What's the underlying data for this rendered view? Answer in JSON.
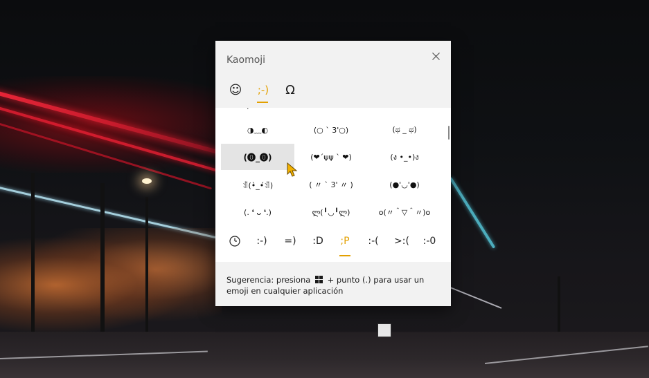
{
  "panel": {
    "title": "Kaomoji",
    "close_glyph": "✕"
  },
  "categories": [
    {
      "name": "emoji",
      "glyph": "☺",
      "icon": "smiley-icon"
    },
    {
      "name": "kaomoji",
      "glyph": ";-)",
      "icon": "kaomoji-icon",
      "active": true
    },
    {
      "name": "symbols",
      "glyph": "Ω",
      "icon": "omega-icon"
    }
  ],
  "grid": {
    "partial_row": ". '",
    "rows": [
      [
        "◑﹏◐",
        "(○ ˋ 3'○)",
        "(ಥ _ ಥ)"
      ],
      [
        "(⓿_⓿)",
        "(❤´ψψ ` ❤)",
        "(ง •_•)ง"
      ],
      [
        "ꀊ(•̀_•́ꀊ)",
        "( 〃 ` 3' 〃 )",
        "(●'◡'●)"
      ],
      [
        "(. ❛ ᴗ ❛.)",
        "ლ(╹◡╹ლ)",
        "o(〃＾▽＾〃)o"
      ]
    ],
    "hovered": "(⓿_⓿)"
  },
  "subcategories": [
    {
      "label": "recent",
      "icon": "clock-icon"
    },
    {
      "label": ":-)"
    },
    {
      "label": "=)"
    },
    {
      "label": ":D"
    },
    {
      "label": ";P",
      "active": true
    },
    {
      "label": ":-("
    },
    {
      "label": ">:("
    },
    {
      "label": ":-0"
    }
  ],
  "footer": {
    "hint_before": "Sugerencia: presiona",
    "hint_after": "+ punto (.) para usar un emoji en cualquier aplicación"
  },
  "colors": {
    "accent": "#e3a000",
    "panel_bg": "#ffffff",
    "header_bg": "#f2f2f2",
    "hover_bg": "#e4e4e4"
  }
}
